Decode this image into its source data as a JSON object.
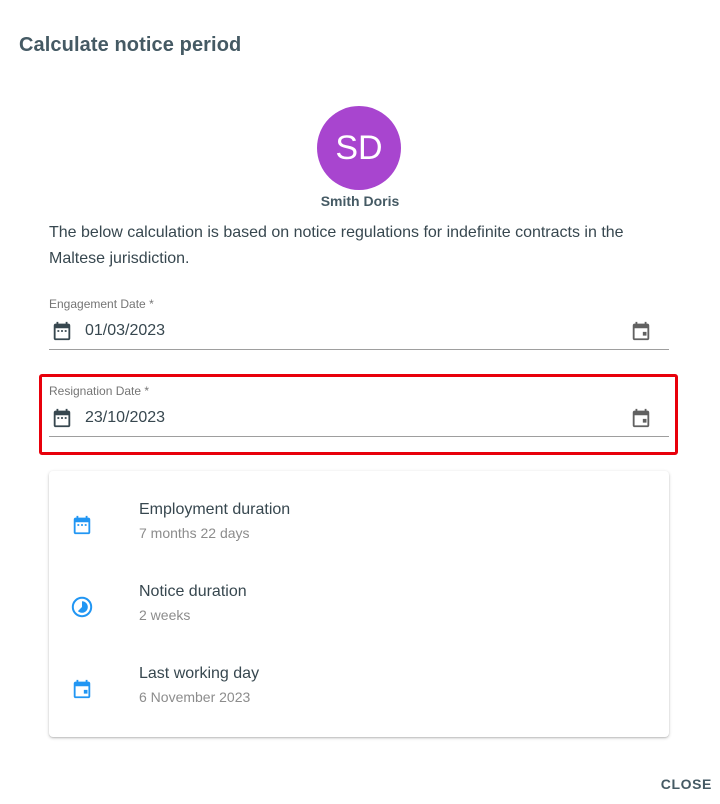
{
  "dialog": {
    "title": "Calculate notice period",
    "close_label": "CLOSE"
  },
  "employee": {
    "initials": "SD",
    "name": "Smith Doris",
    "avatar_color": "#a845cf"
  },
  "description": "The below calculation is based on notice regulations for indefinite contracts in the Maltese jurisdiction.",
  "fields": {
    "engagement": {
      "label": "Engagement Date *",
      "value": "01/03/2023",
      "lead_icon": "calendar-icon",
      "trail_icon": "calendar-today-icon"
    },
    "resignation": {
      "label": "Resignation Date *",
      "value": "23/10/2023",
      "lead_icon": "calendar-icon",
      "trail_icon": "calendar-today-icon",
      "highlight_color": "#e8000b"
    }
  },
  "results": [
    {
      "title": "Employment duration",
      "value": "7 months 22 days",
      "icon": "calendar-month-icon"
    },
    {
      "title": "Notice duration",
      "value": "2 weeks",
      "icon": "timelapse-icon"
    },
    {
      "title": "Last working day",
      "value": "6 November 2023",
      "icon": "event-icon"
    }
  ],
  "colors": {
    "accent": "#2196f3",
    "icon_gray": "#616161"
  }
}
